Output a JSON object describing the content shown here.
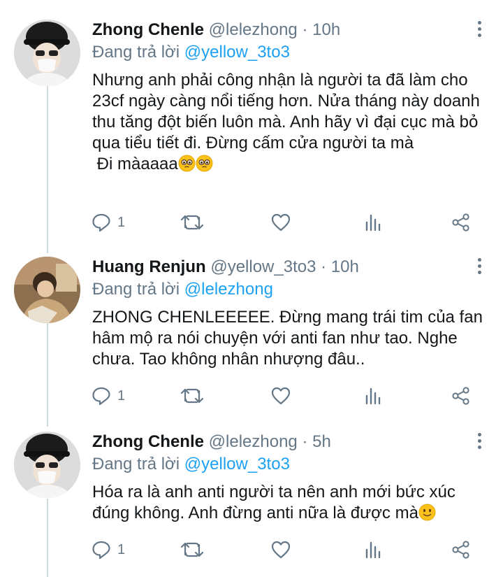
{
  "tweets": [
    {
      "name": "Zhong Chenle",
      "handle": "@lelezhong",
      "time": "10h",
      "replying_prefix": "Đang trả lời",
      "replying_to": "@yellow_3to3",
      "text": "Nhưng anh phải công nhận là người ta đã làm cho 23cf ngày càng nổi tiếng hơn. Nửa tháng này doanh thu tăng đột biến luôn mà. Anh hãy vì đại cục mà bỏ qua tiểu tiết đi. Đừng cấm cửa người ta mà",
      "text2": " Đi màaaaa",
      "reply_count": "1"
    },
    {
      "name": "Huang Renjun",
      "handle": "@yellow_3to3",
      "time": "10h",
      "replying_prefix": "Đang trả lời",
      "replying_to": "@lelezhong",
      "text": "ZHONG CHENLEEEEE. Đừng mang trái tim của fan hâm mộ ra nói chuyện với anti fan như tao. Nghe chưa. Tao không nhân nhượng đâu..",
      "reply_count": "1"
    },
    {
      "name": "Zhong Chenle",
      "handle": "@lelezhong",
      "time": "5h",
      "replying_prefix": "Đang trả lời",
      "replying_to": "@yellow_3to3",
      "text": "Hóa ra là anh anti người ta nên anh mới bức xúc đúng không. Anh đừng anti nữa là được mà",
      "reply_count": "1"
    }
  ],
  "separator": "·",
  "colors": {
    "accent": "#1da1f2",
    "muted": "#657786",
    "line": "#cfd9de"
  }
}
